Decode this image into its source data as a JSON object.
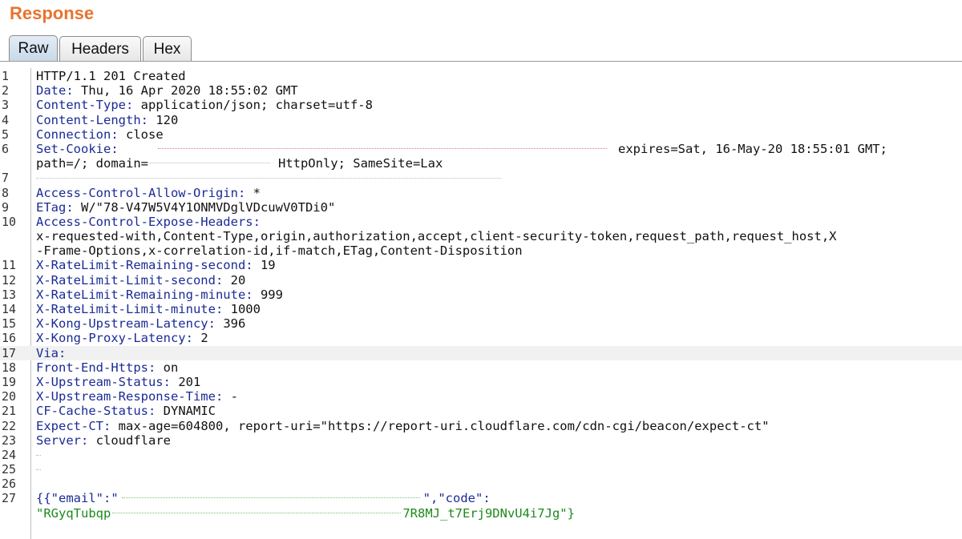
{
  "panel": {
    "title": "Response"
  },
  "tabs": [
    {
      "label": "Raw",
      "active": true
    },
    {
      "label": "Headers",
      "active": false
    },
    {
      "label": "Hex",
      "active": false
    }
  ],
  "lines": {
    "l1": "HTTP/1.1 201 Created",
    "l2k": "Date",
    "l2v": "Thu, 16 Apr 2020 18:55:02 GMT",
    "l3k": "Content-Type",
    "l3v": "application/json; charset=utf-8",
    "l4k": "Content-Length",
    "l4v": "120",
    "l5k": "Connection",
    "l5v": "close",
    "l6k": "Set-Cookie",
    "l6v": "expires=Sat, 16-May-20 18:55:01 GMT;",
    "l6b1": "path=/; domain=",
    "l6b2": "HttpOnly; SameSite=Lax",
    "l8k": "Access-Control-Allow-Origin",
    "l8v": "*",
    "l9k": "ETag",
    "l9v": "W/\"78-V47W5V4Y1ONMVDglVDcuwV0TDi0\"",
    "l10k": "Access-Control-Expose-Headers",
    "l10b1": "x-requested-with,Content-Type,origin,authorization,accept,client-security-token,request_path,request_host,X",
    "l10b2": "-Frame-Options,x-correlation-id,if-match,ETag,Content-Disposition",
    "l11k": "X-RateLimit-Remaining-second",
    "l11v": "19",
    "l12k": "X-RateLimit-Limit-second",
    "l12v": "20",
    "l13k": "X-RateLimit-Remaining-minute",
    "l13v": "999",
    "l14k": "X-RateLimit-Limit-minute",
    "l14v": "1000",
    "l15k": "X-Kong-Upstream-Latency",
    "l15v": "396",
    "l16k": "X-Kong-Proxy-Latency",
    "l16v": "2",
    "l17k": "Via",
    "l18k": "Front-End-Https",
    "l18v": "on",
    "l19k": "X-Upstream-Status",
    "l19v": "201",
    "l20k": "X-Upstream-Response-Time",
    "l20v": "-",
    "l21k": "CF-Cache-Status",
    "l21v": "DYNAMIC",
    "l22k": "Expect-CT",
    "l22v": "max-age=604800, report-uri=\"https://report-uri.cloudflare.com/cdn-cgi/beacon/expect-ct\"",
    "l23k": "Server",
    "l23v": "cloudflare",
    "l27a": "{\"email\":\"",
    "l27b": "\",\"code\":",
    "l27c1": "\"RGyqTubqp",
    "l27c2": "7R8MJ_t7Erj9DNvU4i7Jg\"}"
  },
  "line_numbers": [
    "1",
    "2",
    "3",
    "4",
    "5",
    "6",
    "7",
    "8",
    "9",
    "10",
    "11",
    "12",
    "13",
    "14",
    "15",
    "16",
    "17",
    "18",
    "19",
    "20",
    "21",
    "22",
    "23",
    "24",
    "25",
    "26",
    "27"
  ]
}
